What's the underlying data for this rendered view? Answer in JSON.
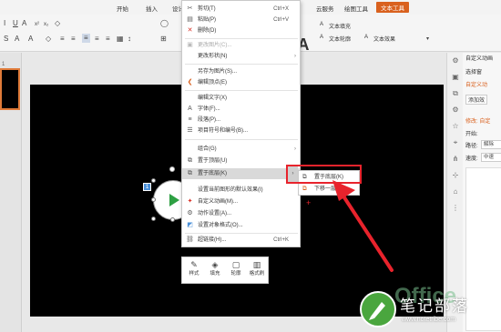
{
  "colors": {
    "accent": "#d9611e",
    "highlight": "#e8232c",
    "slide_bg": "#000000"
  },
  "ribbon": {
    "tabs": [
      "开始",
      "插入",
      "设计",
      "云服务",
      "绘图工具",
      "文本工具"
    ],
    "active_tab": "文本工具",
    "text_fill": "文本填充",
    "text_outline": "文本轮廓",
    "text_effect": "文本效果"
  },
  "context_menu": {
    "items": [
      {
        "icon": "scissors-icon",
        "label": "剪切(T)",
        "shortcut": "Ctrl+X"
      },
      {
        "icon": "clipboard-icon",
        "label": "粘贴(P)",
        "shortcut": "Ctrl+V"
      },
      {
        "icon": "delete-icon",
        "label": "删除(D)"
      },
      {
        "icon": "change-picture-icon",
        "label": "更改图片(C)..."
      },
      {
        "icon": "",
        "label": "更改形状(N)"
      },
      {
        "icon": "",
        "label": "另存为图片(S)..."
      },
      {
        "icon": "edit-points-icon",
        "label": "编辑顶点(E)"
      },
      {
        "icon": "",
        "label": "编辑文字(X)"
      },
      {
        "icon": "font-icon",
        "label": "字体(F)..."
      },
      {
        "icon": "paragraph-icon",
        "label": "段落(P)..."
      },
      {
        "icon": "bullets-icon",
        "label": "项目符号和编号(B)..."
      },
      {
        "icon": "",
        "label": "组合(G)"
      },
      {
        "icon": "bring-front-icon",
        "label": "置于顶层(U)"
      },
      {
        "icon": "send-back-icon",
        "label": "置于底层(K)"
      },
      {
        "icon": "",
        "label": "设置当前图形的默认效果(I)"
      },
      {
        "icon": "custom-anim-icon",
        "label": "自定义动画(M)..."
      },
      {
        "icon": "action-icon",
        "label": "动作设置(A)..."
      },
      {
        "icon": "format-shape-icon",
        "label": "设置对象格式(O)..."
      },
      {
        "icon": "hyperlink-icon",
        "label": "超链接(H)...",
        "shortcut": "Ctrl+K"
      }
    ]
  },
  "submenu": {
    "items": [
      {
        "label": "置于底层(K)"
      },
      {
        "label": "下移一层(B)"
      }
    ]
  },
  "mini_toolbar": {
    "items": [
      {
        "label": "样式"
      },
      {
        "label": "填充"
      },
      {
        "label": "轮廓"
      },
      {
        "label": "格式刷"
      }
    ]
  },
  "slide": {
    "anim_badge": "1"
  },
  "left_pane": {
    "slide_number": "1"
  },
  "right_pane": {
    "title": "自定义动画",
    "select_pane": "选择窗",
    "custom_anim": "自定义动",
    "add_effect": "添加效",
    "modify": "修改: 自定",
    "start_label": "开始:",
    "property_label": "路径:",
    "property_value": "解除",
    "speed_label": "速度:",
    "speed_value": "中速"
  },
  "watermark": {
    "title": "笔记部落",
    "url": "www.notetribe.com",
    "bg_text": "Office"
  }
}
